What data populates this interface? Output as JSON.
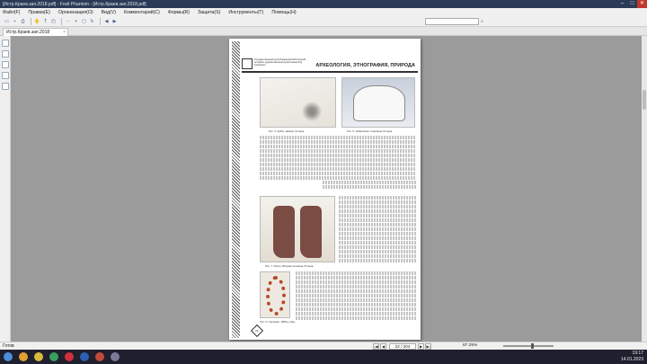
{
  "window": {
    "title": "[Истр.Краев.зап.2018.pdf] - Foxit Phantom - [Истр.Краев.зап.2018.pdf]"
  },
  "menu": [
    "Файл(F)",
    "Правка(E)",
    "Организация(O)",
    "Вид(V)",
    "Комментарий(C)",
    "Формы(R)",
    "Защита(S)",
    "Инструменты(T)",
    "Помощь(H)"
  ],
  "tabs": [
    {
      "label": "Истр.Краев.зап.2018"
    }
  ],
  "document": {
    "section_title": "АРХЕОЛОГИЯ, ЭТНОГРАФИЯ, ПРИРОДА",
    "org_name": "Государственный республиканский Истринский историко-художественный музей имени Б.Д. Гусевского",
    "captions": {
      "fig5": "Рис. 5. Кубок. Начало XX века.",
      "fig6": "Рис. 6. Тюбетейка. Середина XX века.",
      "fig7": "Рис. 7. Ичиги. Вторая половина XX века.",
      "fig8": "Рис. 8. Гирлянда. 1980-е годы."
    },
    "page_number": "22"
  },
  "status": {
    "ready": "Готов",
    "page_indicator": "22 / 204",
    "zoom": "87.25%"
  },
  "tray": {
    "time": "19:17",
    "date": "14.01.2023"
  },
  "colors": {
    "titlebar": "#2b3a55",
    "viewport_bg": "#9b9b9b",
    "taskbar": "#1f1f2e"
  }
}
